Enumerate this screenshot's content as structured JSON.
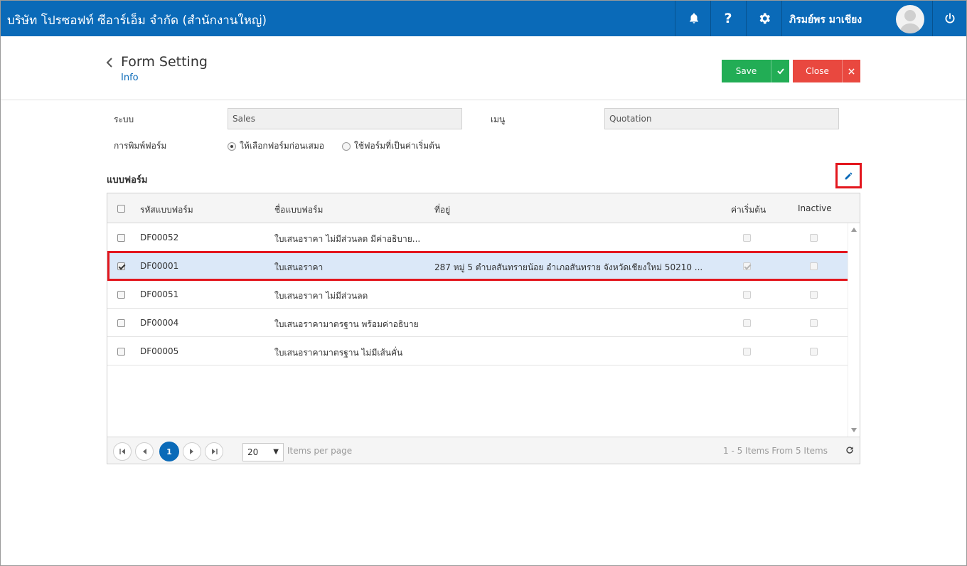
{
  "topbar": {
    "company": "บริษัท โปรซอฟท์ ซีอาร์เอ็ม จำกัด (สำนักงานใหญ่)",
    "username": "ภิรมย์พร มาเชียง",
    "icons": [
      "bell-icon",
      "help-icon",
      "gear-icon",
      "power-icon"
    ]
  },
  "header": {
    "title": "Form Setting",
    "subtitle": "Info",
    "save_label": "Save",
    "close_label": "Close"
  },
  "form": {
    "system_label": "ระบบ",
    "system_value": "Sales",
    "menu_label": "เมนู",
    "menu_value": "Quotation",
    "print_label": "การพิมพ์ฟอร์ม",
    "print_options": [
      "ให้เลือกฟอร์มก่อนเสมอ",
      "ใช้ฟอร์มที่เป็นค่าเริ่มต้น"
    ],
    "print_selected": 0
  },
  "section": {
    "title": "แบบฟอร์ม"
  },
  "grid": {
    "columns": {
      "code": "รหัสแบบฟอร์ม",
      "name": "ชื่อแบบฟอร์ม",
      "address": "ที่อยู่",
      "default": "ค่าเริ่มต้น",
      "inactive": "Inactive"
    },
    "rows": [
      {
        "code": "DF00052",
        "name": "ใบเสนอราคา ไม่มีส่วนลด มีค่าอธิบาย...",
        "address": "",
        "selected": false,
        "default": false,
        "inactive": false
      },
      {
        "code": "DF00001",
        "name": "ใบเสนอราคา",
        "address": "287 หมู่ 5 ตำบลสันทรายน้อย อำเภอสันทราย จังหวัดเชียงใหม่ 50210 ...",
        "selected": true,
        "default": true,
        "inactive": false
      },
      {
        "code": "DF00051",
        "name": "ใบเสนอราคา ไม่มีส่วนลด",
        "address": "",
        "selected": false,
        "default": false,
        "inactive": false
      },
      {
        "code": "DF00004",
        "name": "ใบเสนอราคามาตรฐาน พร้อมค่าอธิบาย",
        "address": "",
        "selected": false,
        "default": false,
        "inactive": false
      },
      {
        "code": "DF00005",
        "name": "ใบเสนอราคามาตรฐาน ไม่มีเส้นคั่น",
        "address": "",
        "selected": false,
        "default": false,
        "inactive": false
      }
    ]
  },
  "pager": {
    "current_page": "1",
    "page_size": "20",
    "per_page_label": "Items per page",
    "summary": "1 - 5 Items From 5 Items"
  },
  "colors": {
    "brand": "#0a6ab8",
    "save": "#22ad55",
    "close": "#e9483f",
    "highlight": "#e3161d"
  }
}
